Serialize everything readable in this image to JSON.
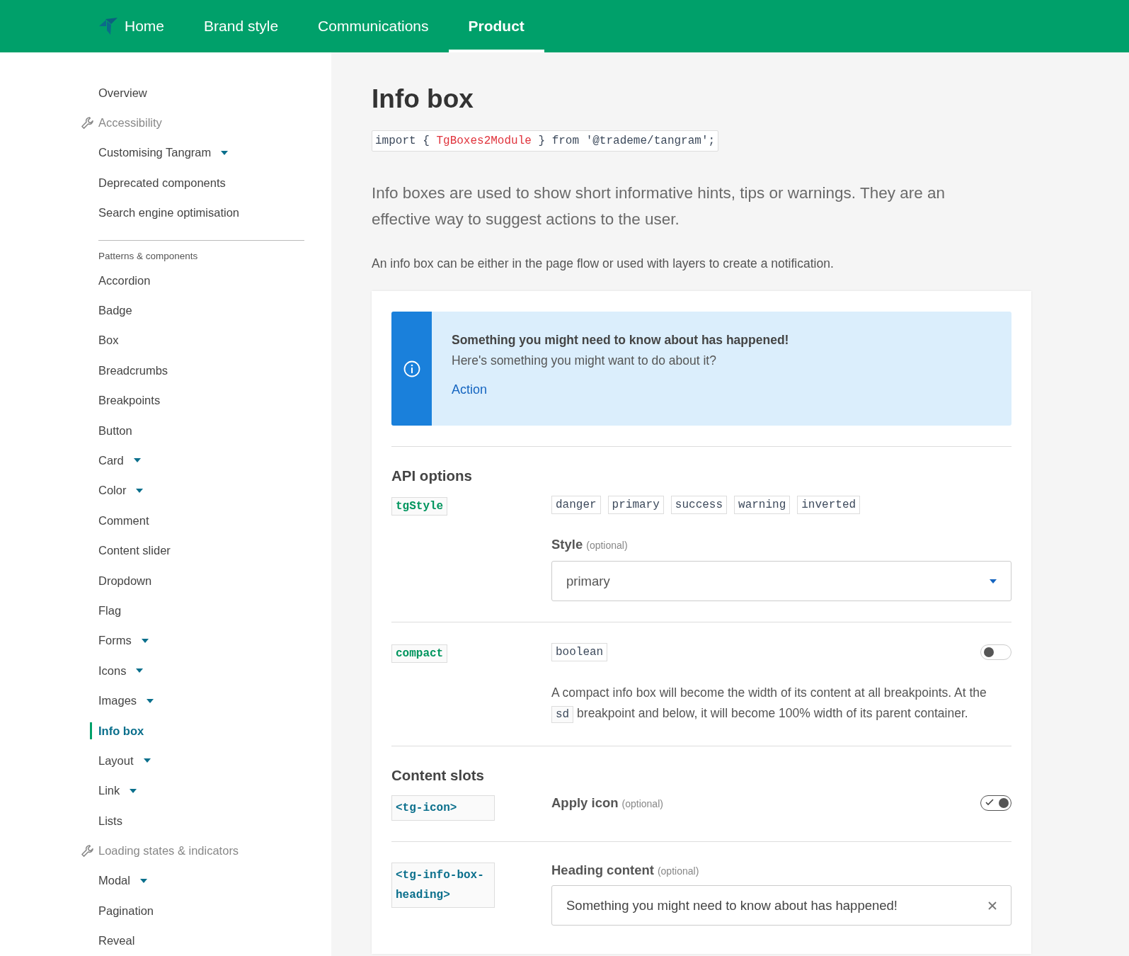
{
  "nav": {
    "items": [
      {
        "label": "Home",
        "selected": false,
        "kind": "logo"
      },
      {
        "label": "Brand style",
        "selected": false,
        "kind": "plain"
      },
      {
        "label": "Communications",
        "selected": false,
        "kind": "plain"
      },
      {
        "label": "Product",
        "selected": true,
        "kind": "plain"
      }
    ]
  },
  "sidebar": {
    "top_items": [
      {
        "label": "Overview",
        "kind": "plain",
        "selected": false
      },
      {
        "label": "Accessibility",
        "kind": "tool",
        "selected": false
      },
      {
        "label": "Customising Tangram",
        "kind": "menu",
        "selected": false
      },
      {
        "label": "Deprecated components",
        "kind": "plain",
        "selected": false
      },
      {
        "label": "Search engine optimisation",
        "kind": "plain",
        "selected": false
      }
    ],
    "section_heading": "Patterns & components",
    "items": [
      {
        "label": "Accordion",
        "kind": "plain",
        "selected": false
      },
      {
        "label": "Badge",
        "kind": "plain",
        "selected": false
      },
      {
        "label": "Box",
        "kind": "plain",
        "selected": false
      },
      {
        "label": "Breadcrumbs",
        "kind": "plain",
        "selected": false
      },
      {
        "label": "Breakpoints",
        "kind": "plain",
        "selected": false
      },
      {
        "label": "Button",
        "kind": "plain",
        "selected": false
      },
      {
        "label": "Card",
        "kind": "menu",
        "selected": false
      },
      {
        "label": "Color",
        "kind": "menu",
        "selected": false
      },
      {
        "label": "Comment",
        "kind": "plain",
        "selected": false
      },
      {
        "label": "Content slider",
        "kind": "plain",
        "selected": false
      },
      {
        "label": "Dropdown",
        "kind": "plain",
        "selected": false
      },
      {
        "label": "Flag",
        "kind": "plain",
        "selected": false
      },
      {
        "label": "Forms",
        "kind": "menu",
        "selected": false
      },
      {
        "label": "Icons",
        "kind": "menu",
        "selected": false
      },
      {
        "label": "Images",
        "kind": "menu",
        "selected": false
      },
      {
        "label": "Info box",
        "kind": "plain",
        "selected": true
      },
      {
        "label": "Layout",
        "kind": "menu",
        "selected": false
      },
      {
        "label": "Link",
        "kind": "menu",
        "selected": false
      },
      {
        "label": "Lists",
        "kind": "plain",
        "selected": false
      },
      {
        "label": "Loading states & indicators",
        "kind": "tool",
        "selected": false
      },
      {
        "label": "Modal",
        "kind": "menu",
        "selected": false
      },
      {
        "label": "Pagination",
        "kind": "plain",
        "selected": false
      },
      {
        "label": "Reveal",
        "kind": "plain",
        "selected": false
      }
    ]
  },
  "page": {
    "title": "Info box",
    "import_code": {
      "before": "import { ",
      "highlight": "TgBoxes2Module",
      "after": " } from '@trademe/tangram';"
    },
    "lead": "Info boxes are used to show short informative hints, tips or warnings. They are an effective way to suggest actions to the user.",
    "paragraph": "An info box can be either in the page flow or used with layers to create a notification."
  },
  "demo": {
    "info_box": {
      "heading": "Something you might need to know about has happened!",
      "body": "Here's something you might want to do about it?",
      "action": "Action"
    },
    "api_options": {
      "heading": "API options",
      "options": [
        {
          "kind": "enum",
          "name": "tgStyle",
          "values": [
            "danger",
            "primary",
            "success",
            "warning",
            "inverted"
          ],
          "field_label": "Style",
          "field_hint": "(optional)",
          "value": "primary"
        },
        {
          "kind": "boolean",
          "name": "compact",
          "type": "boolean",
          "on": false,
          "description_before": "A compact info box will become the width of its content at all breakpoints. At the",
          "description_code": "sd",
          "description_after": "breakpoint and below, it will become 100% width of its parent container."
        }
      ]
    },
    "content_slots": {
      "heading": "Content slots",
      "slots": [
        {
          "kind": "toggle",
          "tag": "<tg-icon>",
          "label": "Apply icon",
          "hint": "(optional)",
          "on": true
        },
        {
          "kind": "text",
          "tag": "<tg-info-box-heading>",
          "label": "Heading content",
          "hint": "(optional)",
          "value": "Something you might need to know about has happened!"
        }
      ]
    }
  }
}
